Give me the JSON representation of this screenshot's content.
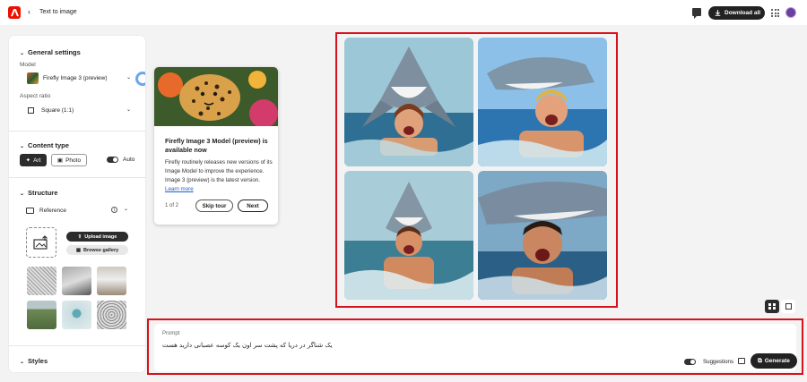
{
  "header": {
    "breadcrumb": "Text to image",
    "download_all": "Download all",
    "icons": [
      "adobe-logo",
      "back-chevron-icon",
      "chat-icon",
      "download-icon",
      "apps-grid-icon",
      "avatar"
    ]
  },
  "sidebar": {
    "general": {
      "title": "General settings",
      "model_label": "Model",
      "model_value": "Firefly Image 3 (preview)",
      "aspect_label": "Aspect ratio",
      "aspect_value": "Square (1:1)"
    },
    "content_type": {
      "title": "Content type",
      "art": "Art",
      "photo": "Photo",
      "auto": "Auto"
    },
    "structure": {
      "title": "Structure",
      "reference": "Reference",
      "upload_image": "Upload image",
      "browse_gallery": "Browse gallery"
    },
    "styles": {
      "title": "Styles"
    }
  },
  "popover": {
    "title": "Firefly Image 3 Model (preview) is available now",
    "body": "Firefly routinely releases new versions of its Image Model to improve the experience. Image 3 (preview) is the latest version.",
    "link": "Learn more",
    "steps": "1 of 2",
    "skip": "Skip tour",
    "next": "Next"
  },
  "prompt": {
    "label": "Prompt",
    "value": "یک شناگر در دریا که پشت سر اون یک کوسه عصبانی دارید هست",
    "suggestions": "Suggestions",
    "generate": "Generate"
  },
  "colors": {
    "brand": "#eb1000",
    "highlight": "#d8121c",
    "dark_button": "#222222"
  }
}
